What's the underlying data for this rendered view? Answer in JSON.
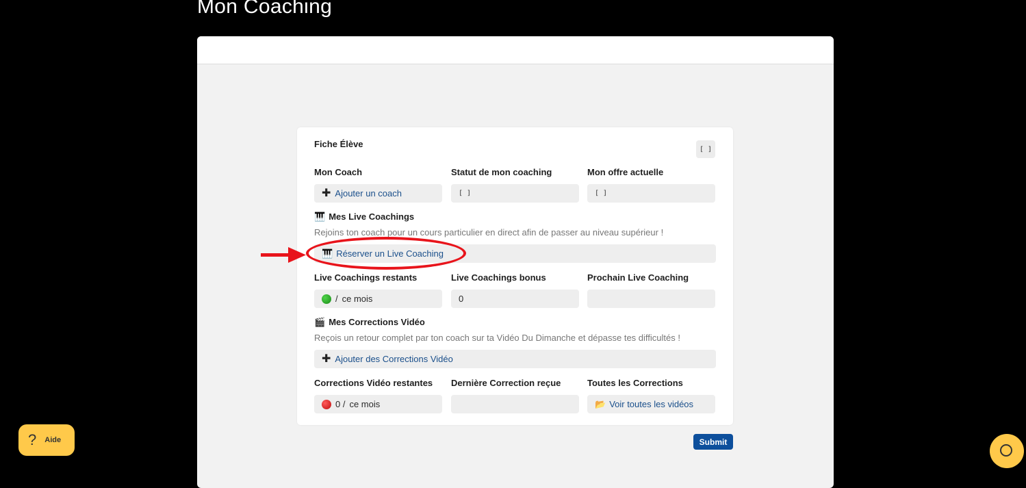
{
  "page": {
    "title": "Mon Coaching"
  },
  "card": {
    "title": "Fiche Élève",
    "corner_button": "[ ]",
    "row1": {
      "coach": {
        "label": "Mon Coach",
        "value": "Ajouter un coach",
        "icon": "plus-icon"
      },
      "status": {
        "label": "Statut de mon coaching",
        "value": "[ ]"
      },
      "offer": {
        "label": "Mon offre actuelle",
        "value": "[ ]"
      }
    },
    "live": {
      "title": "Mes Live Coachings",
      "icon": "piano-icon",
      "description": "Rejoins ton coach pour un cours particulier en direct afin de passer au niveau supérieur !",
      "book_label": "Réserver un Live Coaching"
    },
    "row2": {
      "remaining": {
        "label": "Live Coachings restants",
        "status_color": "green",
        "slash": "/",
        "suffix": "ce mois"
      },
      "bonus": {
        "label": "Live Coachings bonus",
        "value": "0"
      },
      "next": {
        "label": "Prochain Live Coaching",
        "value": ""
      }
    },
    "video": {
      "title": "Mes Corrections Vidéo",
      "icon": "clapper-icon",
      "description": "Reçois un retour complet par ton coach sur ta Vidéo Du Dimanche et dépasse tes difficultés !",
      "add_label": "Ajouter des Corrections Vidéo"
    },
    "row3": {
      "remaining": {
        "label": "Corrections Vidéo restantes",
        "status_color": "red",
        "count": "0 /",
        "suffix": "ce mois"
      },
      "last": {
        "label": "Dernière Correction reçue",
        "value": ""
      },
      "all": {
        "label": "Toutes les Corrections",
        "value": "Voir toutes les vidéos",
        "icon": "folder-icon"
      }
    }
  },
  "actions": {
    "submit": "Submit"
  },
  "help": {
    "label": "Aide"
  },
  "colors": {
    "accent": "#0d4f9c",
    "link": "#1a4f8b",
    "help_yellow": "#ffc94a",
    "annotation_red": "#e8141b"
  }
}
